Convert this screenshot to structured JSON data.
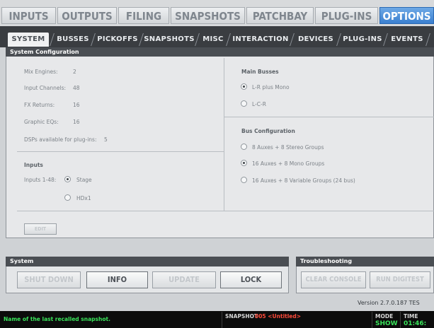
{
  "top_tabs": [
    "INPUTS",
    "OUTPUTS",
    "FILING",
    "SNAPSHOTS",
    "PATCHBAY",
    "PLUG-INS",
    "OPTIONS"
  ],
  "sub_tabs": [
    "SYSTEM",
    "BUSSES",
    "PICKOFFS",
    "SNAPSHOTS",
    "MISC",
    "INTERACTION",
    "DEVICES",
    "PLUG-INS",
    "EVENTS"
  ],
  "system_config": {
    "title": "System Configuration",
    "rows": [
      {
        "label": "Mix Engines:",
        "value": "2"
      },
      {
        "label": "Input Channels:",
        "value": "48"
      },
      {
        "label": "FX Returns:",
        "value": "16"
      },
      {
        "label": "Graphic EQs:",
        "value": "16"
      },
      {
        "label": "DSPs available for plug-ins:",
        "value": "5"
      }
    ],
    "inputs": {
      "title": "Inputs",
      "label": "Inputs 1-48:",
      "options": [
        "Stage",
        "HDx1"
      ],
      "selected": "Stage"
    },
    "main_busses": {
      "title": "Main Busses",
      "options": [
        "L-R plus Mono",
        "L-C-R"
      ],
      "selected": "L-R plus Mono"
    },
    "bus_configuration": {
      "title": "Bus Configuration",
      "options": [
        "8 Auxes + 8 Stereo Groups",
        "16 Auxes + 8 Mono Groups",
        "16 Auxes + 8 Variable Groups (24 bus)"
      ],
      "selected": "16 Auxes + 8 Mono Groups"
    },
    "edit_label": "EDIT"
  },
  "system_panel": {
    "title": "System",
    "buttons": [
      "SHUT DOWN",
      "INFO",
      "UPDATE",
      "LOCK"
    ]
  },
  "troubleshooting_panel": {
    "title": "Troubleshooting",
    "buttons": [
      "CLEAR CONSOLE",
      "RUN DIGITEST"
    ]
  },
  "version": "Version 2.7.0.187 TES",
  "status": {
    "message": "Name of the last recalled snapshot.",
    "snapshot_label": "SNAPSHOT",
    "snapshot_value": "005 <Untitled>",
    "mode_label": "MODE",
    "mode_value": "SHOW",
    "time_label": "TIME",
    "time_value": "01:46:"
  },
  "colors": {
    "accent": "#3a7fd0",
    "status_green": "#39e35a",
    "status_red": "#ff4a3a"
  }
}
